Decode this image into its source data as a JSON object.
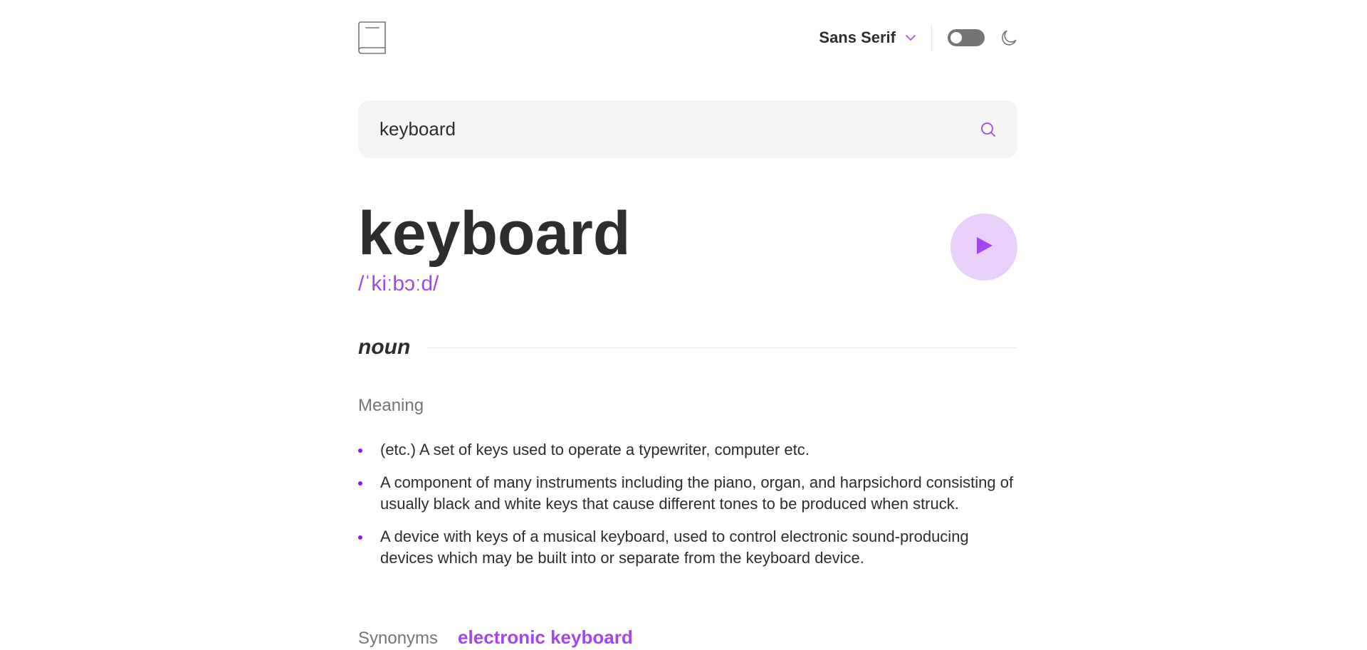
{
  "header": {
    "logo_icon": "book-icon",
    "font_select": {
      "selected": "Sans Serif",
      "icon": "chevron-down-icon"
    },
    "theme_toggle": {
      "state": "off"
    },
    "theme_icon": "moon-icon"
  },
  "search": {
    "value": "keyboard",
    "icon": "search-icon"
  },
  "entry": {
    "word": "keyboard",
    "phonetic": "/ˈkiːbɔːd/",
    "play_icon": "play-icon",
    "part_of_speech": "noun",
    "meaning_heading": "Meaning",
    "definitions": [
      "(etc.) A set of keys used to operate a typewriter, computer etc.",
      "A component of many instruments including the piano, organ, and harpsichord consisting of usually black and white keys that cause different tones to be produced when struck.",
      "A device with keys of a musical keyboard, used to control electronic sound-producing devices which may be built into or separate from the keyboard device."
    ],
    "synonyms_label": "Synonyms",
    "synonyms": [
      "electronic keyboard"
    ]
  },
  "colors": {
    "accent": "#a445ed",
    "accent_light": "#e9d0fa",
    "text": "#2d2d2d",
    "muted": "#757575",
    "search_bg": "#f4f4f4"
  }
}
